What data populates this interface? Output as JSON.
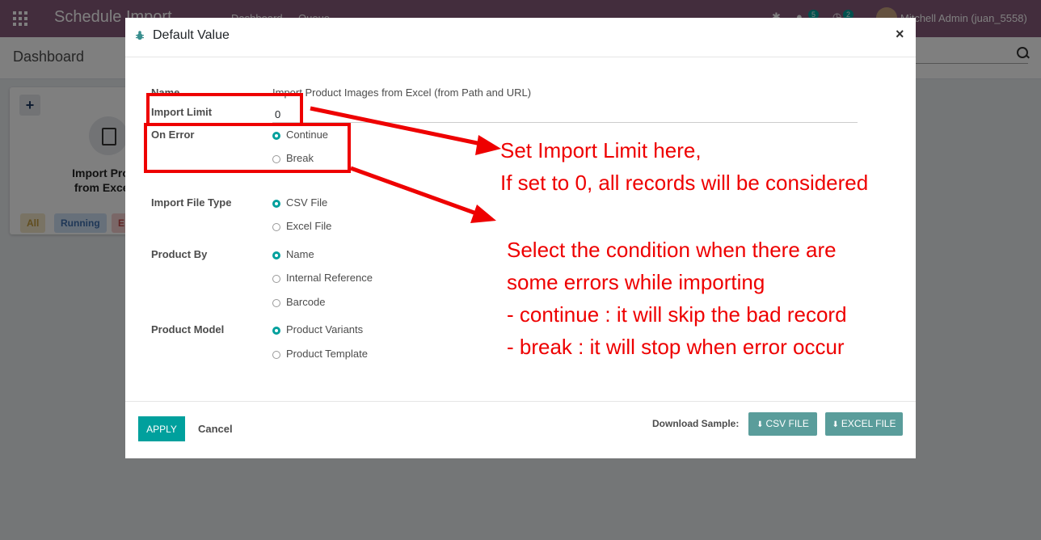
{
  "app": {
    "brand": "Schedule Import",
    "menu": [
      "Dashboard",
      "Queue"
    ],
    "badges": {
      "chat": "5",
      "activity": "2"
    },
    "user": "Mitchell Admin (juan_5558)"
  },
  "control_panel": {
    "breadcrumb": "Dashboard"
  },
  "card": {
    "title": "Import Product Images from Excel (from Path and URL)",
    "title_visible": "Import Produc… from Excel (fro…",
    "filters": [
      "All",
      "Running",
      "E"
    ]
  },
  "modal": {
    "title": "Default Value",
    "close": "×",
    "fields": {
      "name_label": "Name",
      "name_value": "Import Product Images from Excel (from Path and URL)",
      "import_limit_label": "Import Limit",
      "import_limit_value": "0",
      "on_error_label": "On Error",
      "on_error_options": [
        "Continue",
        "Break"
      ],
      "on_error_selected": "Continue",
      "import_file_type_label": "Import File Type",
      "import_file_type_options": [
        "CSV File",
        "Excel File"
      ],
      "import_file_type_selected": "CSV File",
      "product_by_label": "Product By",
      "product_by_options": [
        "Name",
        "Internal Reference",
        "Barcode"
      ],
      "product_by_selected": "Name",
      "product_model_label": "Product Model",
      "product_model_options": [
        "Product Variants",
        "Product Template"
      ],
      "product_model_selected": "Product Variants"
    },
    "footer": {
      "apply": "APPLY",
      "cancel": "Cancel",
      "download_label": "Download Sample:",
      "csv_button": "CSV FILE",
      "excel_button": "EXCEL FILE"
    }
  },
  "annotations": {
    "limit_note": [
      "Set Import Limit here,",
      "If set to 0, all records will be considered"
    ],
    "error_note": [
      "Select the condition when there are",
      "some errors while importing",
      "- continue : it will skip the bad record",
      "- break : it will stop when error occur"
    ],
    "color": "#ee0000"
  },
  "colors": {
    "topbar": "#875a7b",
    "primary": "#00a09d",
    "sample_button": "#5a9d9b"
  }
}
